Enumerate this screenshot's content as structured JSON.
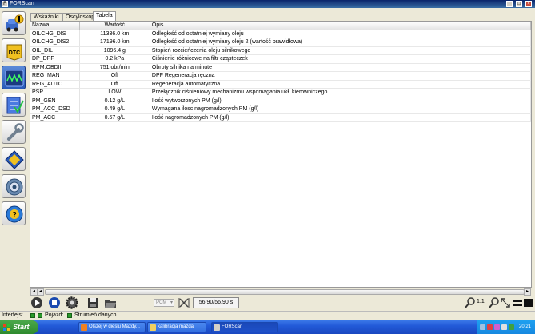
{
  "window": {
    "title": "FORScan"
  },
  "tabs": [
    {
      "label": "Wskaźniki",
      "selected": false
    },
    {
      "label": "Oscyloskop",
      "selected": false
    },
    {
      "label": "Tabela",
      "selected": true
    }
  ],
  "table": {
    "headers": {
      "name": "Nazwa",
      "value": "Wartość",
      "desc": "Opis"
    },
    "rows": [
      {
        "name": "OILCHG_DIS",
        "value": "11336.0 km",
        "desc": "Odległość od ostatniej wymiany oleju"
      },
      {
        "name": "OILCHG_DIS2",
        "value": "17196.0 km",
        "desc": "Odległość od ostatniej wymiany oleju 2 (wartość prawidłowa)"
      },
      {
        "name": "OIL_DIL",
        "value": "1096.4 g",
        "desc": "Stopień rozcieńczenia oleju silnikowego"
      },
      {
        "name": "DP_DPF",
        "value": "0.2 kPa",
        "desc": "Ciśnienie różnicowe na filtr cząsteczek"
      },
      {
        "name": "RPM.OBDII",
        "value": "751 obr/min",
        "desc": "Obroty silnika na minute"
      },
      {
        "name": "REG_MAN",
        "value": "Off",
        "desc": "DPF Regeneracja ręczna"
      },
      {
        "name": "REG_AUTO",
        "value": "Off",
        "desc": "Regeneracja automatyczna"
      },
      {
        "name": "PSP",
        "value": "LOW",
        "desc": "Przełącznik ciśnieniowy mechanizmu wspomagania ukł. kierowniczego"
      },
      {
        "name": "PM_GEN",
        "value": "0.12 g/L",
        "desc": "Ilość wytworzonych PM (g/l)"
      },
      {
        "name": "PM_ACC_DSD",
        "value": "0.49 g/L",
        "desc": "Wymagana ilosc nagromadzonych PM (g/l)"
      },
      {
        "name": "PM_ACC",
        "value": "0.57 g/L",
        "desc": "Ilość nagromadzonych PM (g/l)"
      }
    ]
  },
  "toolbar": {
    "rate_select": "PCM",
    "time_display": "56.90/56.90 s",
    "zoom_label": "1:1"
  },
  "statusbar": {
    "interface_label": "Interfejs:",
    "vehicle_label": "Pojazd:",
    "stream_label": "Strumień danych..."
  },
  "taskbar": {
    "start_label": "Start",
    "tasks": [
      {
        "label": "Olszej w dieslu Mazdy..."
      },
      {
        "label": "kalibracja mazda"
      },
      {
        "label": "FORScan"
      }
    ],
    "clock": "20:21"
  },
  "colors": {
    "accent": "#2a5ab8",
    "taskbar": "#225ad8",
    "start": "#2e8a2e",
    "status_led": "#2a9a2a"
  },
  "icons": {
    "sidebar": [
      "car-info-icon",
      "dtc-icon",
      "oscilloscope-icon",
      "checklist-icon",
      "wrench-icon",
      "chip-icon",
      "gear-icon",
      "help-icon"
    ]
  }
}
